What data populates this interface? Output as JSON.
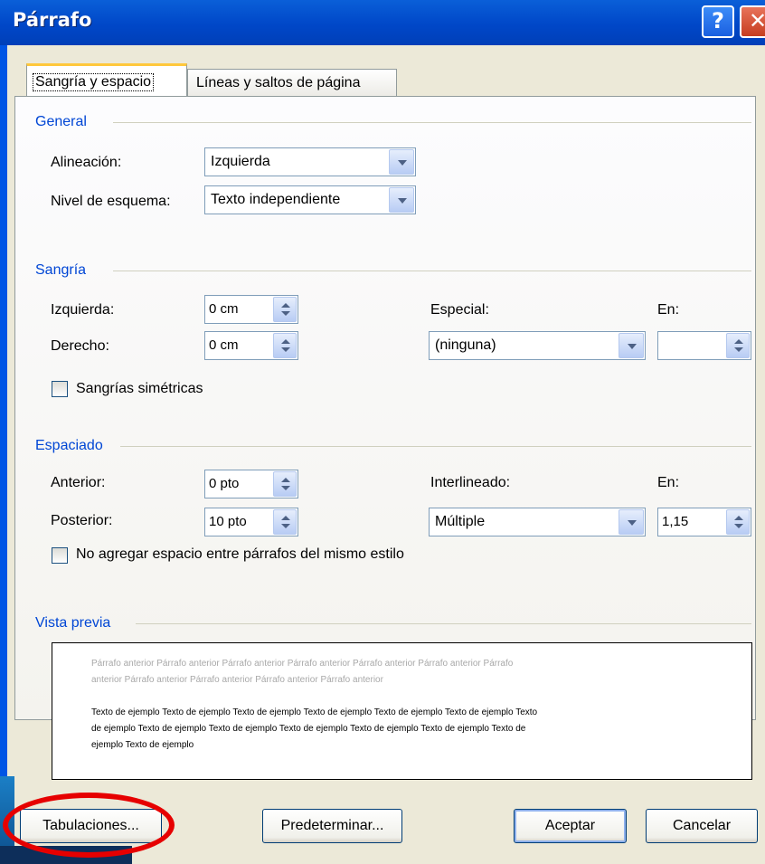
{
  "window": {
    "title": "Párrafo",
    "help_glyph": "?",
    "close_glyph": "✕"
  },
  "tabs": [
    {
      "label": "Sangría y espacio",
      "active": true
    },
    {
      "label": "Líneas y saltos de página",
      "active": false
    }
  ],
  "general": {
    "header": "General",
    "alignment_label": "Alineación:",
    "alignment_value": "Izquierda",
    "outline_label": "Nivel de esquema:",
    "outline_value": "Texto independiente"
  },
  "indent": {
    "header": "Sangría",
    "left_label": "Izquierda:",
    "left_value": "0 cm",
    "right_label": "Derecho:",
    "right_value": "0 cm",
    "special_label": "Especial:",
    "special_value": "(ninguna)",
    "by_label": "En:",
    "by_value": "",
    "mirror_label": "Sangrías simétricas",
    "mirror_checked": false
  },
  "spacing": {
    "header": "Espaciado",
    "before_label": "Anterior:",
    "before_value": "0 pto",
    "after_label": "Posterior:",
    "after_value": "10 pto",
    "line_label": "Interlineado:",
    "line_value": "Múltiple",
    "at_label": "En:",
    "at_value": "1,15",
    "no_space_label": "No agregar espacio entre párrafos del mismo estilo",
    "no_space_checked": false
  },
  "preview": {
    "header": "Vista previa",
    "prev_line1": "Párrafo anterior Párrafo anterior Párrafo anterior Párrafo anterior Párrafo anterior Párrafo anterior Párrafo",
    "prev_line2": "anterior Párrafo anterior Párrafo anterior Párrafo anterior Párrafo anterior",
    "sample_line1": "Texto de ejemplo Texto de ejemplo Texto de ejemplo Texto de ejemplo Texto de ejemplo Texto de ejemplo Texto",
    "sample_line2": "de ejemplo Texto de ejemplo Texto de ejemplo Texto de ejemplo Texto de ejemplo Texto de ejemplo Texto de",
    "sample_line3": "ejemplo Texto de ejemplo"
  },
  "buttons": {
    "tabs": "Tabulaciones...",
    "default": "Predeterminar...",
    "ok": "Aceptar",
    "cancel": "Cancelar"
  },
  "colors": {
    "group_header": "#0046d5",
    "title_bar": "#0047c8",
    "highlight_circle": "#e60000",
    "dialog_bg": "#ece9d8"
  }
}
